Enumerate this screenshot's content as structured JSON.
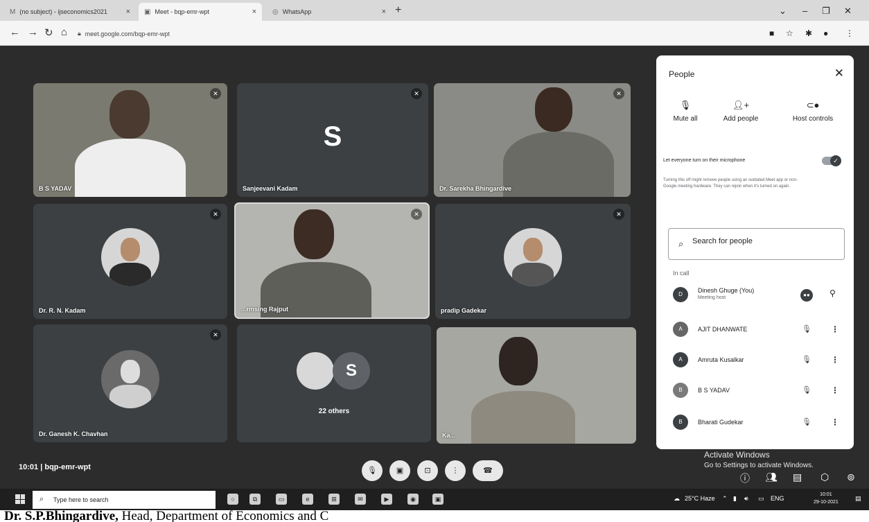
{
  "browser": {
    "tabs": [
      {
        "icon": "gmail-icon",
        "title": "(no subject) - ijseconomics2021",
        "close": "×",
        "active": false
      },
      {
        "icon": "meet-icon",
        "title": "Meet - bqp-emr-wpt",
        "close": "×",
        "active": true
      },
      {
        "icon": "whatsapp-icon",
        "title": "WhatsApp",
        "close": "×",
        "active": false
      }
    ],
    "new_tab": "+",
    "url": "meet.google.com/bqp-emr-wpt"
  },
  "tiles": [
    {
      "name": "B S YADAV",
      "kind": "video"
    },
    {
      "name": "Sanjeevani Kadam",
      "kind": "letter",
      "letter": "S"
    },
    {
      "name": "Dr. Sarekha Bhingardive",
      "kind": "video"
    },
    {
      "name": "Dr. R. N. Kadam",
      "kind": "avatar"
    },
    {
      "name": "...rmsing Rajput",
      "kind": "video"
    },
    {
      "name": "pradip Gadekar",
      "kind": "avatar"
    },
    {
      "name": "Dr. Ganesh K. Chavhan",
      "kind": "avatar"
    },
    {
      "name": "22 others",
      "kind": "others",
      "letter": "S"
    },
    {
      "name": "Ka...",
      "kind": "video"
    }
  ],
  "meeting": {
    "time": "10:01",
    "separator": "|",
    "code": "bqp-emr-wpt"
  },
  "panel": {
    "title": "People",
    "actions": [
      {
        "label": "Mute all",
        "icon": "mic-off-icon"
      },
      {
        "label": "Add people",
        "icon": "add-person-icon"
      },
      {
        "label": "Host controls",
        "icon": "host-controls-icon"
      }
    ],
    "mic_setting_label": "Let everyone turn on their microphone",
    "mic_note": "Turning this off might remove people using an outdated Meet app or non-Google meeting hardware. They can rejoin when it's turned on again.",
    "search_placeholder": "Search for people",
    "section_label": "In call",
    "participants": [
      {
        "name": "Dinesh Ghuge (You)",
        "role": "Meeting host"
      },
      {
        "name": "AJIT DHANWATE",
        "role": ""
      },
      {
        "name": "Amruta Kusalkar",
        "role": ""
      },
      {
        "name": "B S YADAV",
        "role": ""
      },
      {
        "name": "Bharati Gudekar",
        "role": ""
      }
    ]
  },
  "windows": {
    "activate_title": "Activate Windows",
    "activate_sub": "Go to Settings to activate Windows.",
    "search_text": "Type here to search",
    "weather": "25°C Haze",
    "lang": "ENG",
    "time": "10:01",
    "date": "29-10-2021"
  },
  "caption": {
    "bold": "Dr. S.P.Bhingardive,",
    "rest": " Head, Department of Economics and C"
  }
}
